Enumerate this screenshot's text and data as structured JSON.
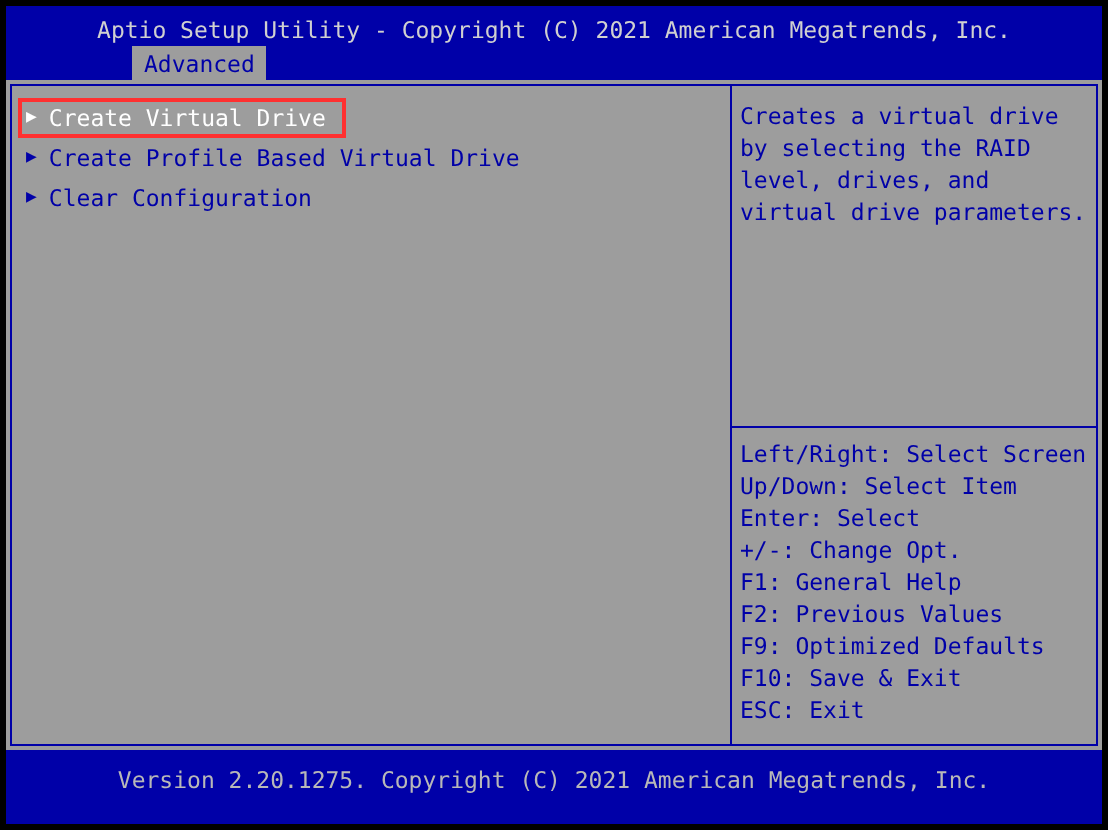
{
  "header": {
    "title": "Aptio Setup Utility - Copyright (C) 2021 American Megatrends, Inc.",
    "tabs": [
      {
        "label": "Advanced",
        "selected": true
      }
    ]
  },
  "menu": {
    "items": [
      {
        "marker": "▶",
        "label": "Create Virtual Drive",
        "selected": true,
        "annotated": true
      },
      {
        "marker": "▶",
        "label": "Create Profile Based Virtual Drive",
        "selected": false,
        "annotated": false
      },
      {
        "marker": "▶",
        "label": "Clear Configuration",
        "selected": false,
        "annotated": false
      }
    ]
  },
  "help": {
    "description": "Creates a virtual drive by selecting the RAID level, drives, and virtual drive parameters.",
    "keys": [
      "Left/Right: Select Screen",
      "Up/Down: Select Item",
      "Enter: Select",
      "+/-: Change Opt.",
      "F1: General Help",
      "F2: Previous Values",
      "F9: Optimized Defaults",
      "F10: Save & Exit",
      "ESC: Exit"
    ]
  },
  "footer": {
    "version": "Version 2.20.1275. Copyright (C) 2021 American Megatrends, Inc."
  }
}
